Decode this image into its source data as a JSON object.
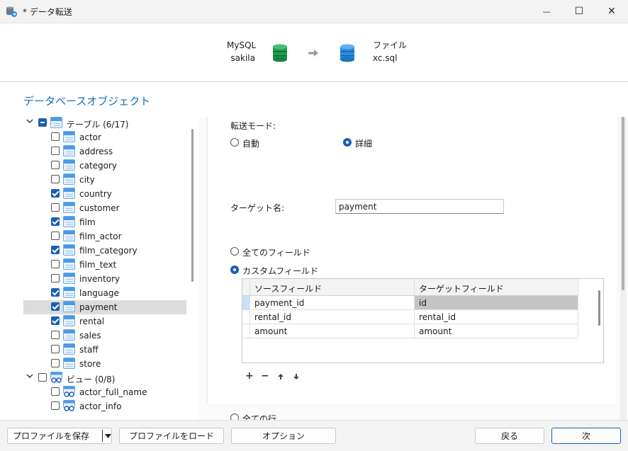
{
  "window": {
    "title": "* データ転送",
    "minimize_glyph": "—",
    "maximize_glyph": "☐",
    "close_glyph": "✕"
  },
  "header": {
    "source_type": "MySQL",
    "source_db": "sakila",
    "target_type": "ファイル",
    "target_name": "xc.sql"
  },
  "section_title": "データベースオブジェクト",
  "tree": {
    "tables_group": {
      "label": "テーブル (6/17)",
      "state": "partial"
    },
    "tables": [
      {
        "label": "actor",
        "checked": false
      },
      {
        "label": "address",
        "checked": false
      },
      {
        "label": "category",
        "checked": false
      },
      {
        "label": "city",
        "checked": false
      },
      {
        "label": "country",
        "checked": true
      },
      {
        "label": "customer",
        "checked": false
      },
      {
        "label": "film",
        "checked": true
      },
      {
        "label": "film_actor",
        "checked": false
      },
      {
        "label": "film_category",
        "checked": true
      },
      {
        "label": "film_text",
        "checked": false
      },
      {
        "label": "inventory",
        "checked": false
      },
      {
        "label": "language",
        "checked": true
      },
      {
        "label": "payment",
        "checked": true,
        "selected": true
      },
      {
        "label": "rental",
        "checked": true
      },
      {
        "label": "sales",
        "checked": false
      },
      {
        "label": "staff",
        "checked": false
      },
      {
        "label": "store",
        "checked": false
      }
    ],
    "views_group": {
      "label": "ビュー (0/8)",
      "state": "unchecked"
    },
    "views": [
      {
        "label": "actor_full_name",
        "checked": false
      },
      {
        "label": "actor_info",
        "checked": false
      }
    ]
  },
  "settings": {
    "transfer_mode_label": "転送モード:",
    "mode_auto": "自動",
    "mode_detail": "詳細",
    "target_name_label": "ターゲット名:",
    "target_name_value": "payment",
    "all_fields": "全てのフィールド",
    "custom_fields": "カスタムフィールド",
    "all_rows": "全ての行"
  },
  "field_grid": {
    "headers": [
      "ソースフィールド",
      "ターゲットフィールド"
    ],
    "rows": [
      {
        "source": "payment_id",
        "target": "id"
      },
      {
        "source": "rental_id",
        "target": "rental_id"
      },
      {
        "source": "amount",
        "target": "amount"
      }
    ],
    "add_glyph": "+",
    "remove_glyph": "−",
    "up_glyph": "🠕",
    "down_glyph": "🠗"
  },
  "buttons": {
    "save_profile": "プロファイルを保存",
    "load_profile": "プロファイルをロード",
    "options": "オプション",
    "back": "戻る",
    "next": "次"
  },
  "colors": {
    "accent": "#1a5fb4",
    "section_title": "#1a6fb5",
    "mysql_db": "#1e9e4f",
    "file_db": "#2b8be0"
  }
}
